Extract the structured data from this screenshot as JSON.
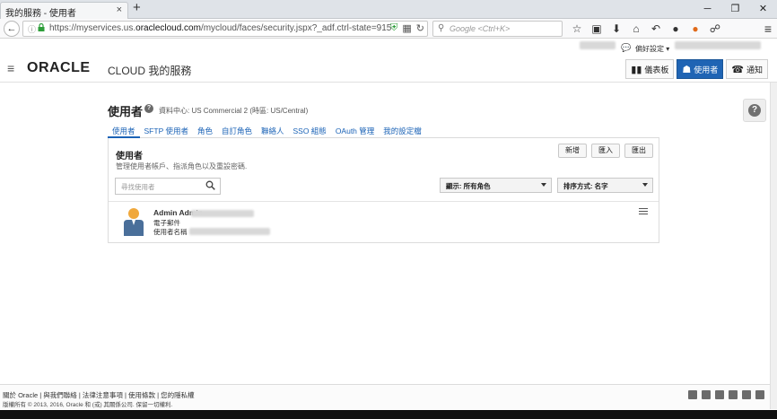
{
  "browser": {
    "tab_title": "我的服務 - 使用者",
    "tab_close": "×",
    "new_tab": "+",
    "win_min": "─",
    "win_max": "❐",
    "win_close": "✕",
    "url_prefix": "https://myservices.us.",
    "url_domain": "oraclecloud.com",
    "url_suffix": "/mycloud/faces/security.jspx?_adf.ctrl-state=915",
    "search_placeholder": "Google <Ctrl+K>",
    "nav_back": "←",
    "menu": "≡"
  },
  "topbar": {
    "preferences": "偏好設定 ▾"
  },
  "header": {
    "logo": "ORACLE",
    "cloud_label": "CLOUD 我的服務",
    "buttons": [
      {
        "label": "儀表板",
        "icon": "dashboard-icon",
        "glyph": "▮▮▮"
      },
      {
        "label": "使用者",
        "icon": "users-icon",
        "glyph": "👥"
      },
      {
        "label": "通知",
        "icon": "notifications-icon",
        "glyph": "☊"
      }
    ]
  },
  "page": {
    "title": "使用者",
    "help": "?",
    "datacenter": "資料中心: US Commercial 2 (時區: US/Central)",
    "tabs": [
      "使用者",
      "SFTP 使用者",
      "角色",
      "自訂角色",
      "聯絡人",
      "SSO 組態",
      "OAuth 管理",
      "我的設定檔"
    ],
    "active_tab": 0
  },
  "panel": {
    "title": "使用者",
    "subtitle": "管理使用者帳戶、指派角色以及重設密碼.",
    "actions": [
      "新增",
      "匯入",
      "匯出"
    ],
    "search_placeholder": "尋找使用者",
    "filter_select": "顯示: 所有角色",
    "sort_select": "排序方式: 名字",
    "users": [
      {
        "name": "Admin Admin",
        "email_label": "電子郵件",
        "login_label": "使用者名稱"
      }
    ]
  },
  "footer": {
    "links": "關於 Oracle | 與我們聯絡 | 法律注意事項 | 使用條款 | 您的隱私權",
    "copyright": "版權所有 © 2013, 2016, Oracle 和 (或) 其關係公司. 保留一切權利."
  },
  "help_side": "?",
  "colors": {
    "accent": "#1f64b4",
    "link": "#1a62b6"
  }
}
